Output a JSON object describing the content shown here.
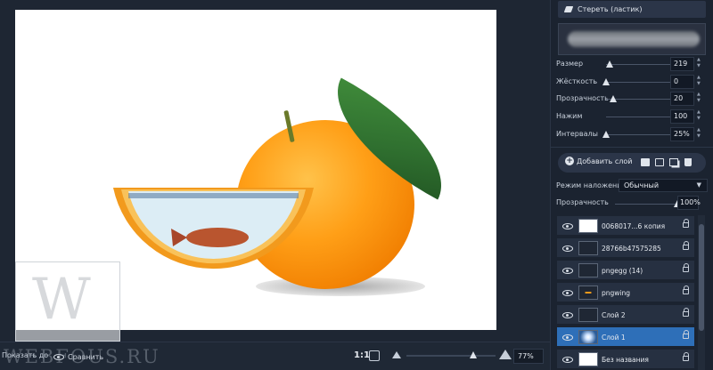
{
  "bottom_bar": {
    "label_left": "Показать до",
    "compare_label": "Сравнить",
    "ratio_label": "1:1",
    "zoom_value": "77%",
    "zoom_level": 0.75
  },
  "watermark": {
    "letter": "W",
    "text": "WEBFOUS.RU"
  },
  "tool": {
    "eraser_label": "Стереть (ластик)"
  },
  "params": [
    {
      "label": "Размер",
      "value": "219",
      "level": 0.05
    },
    {
      "label": "Жёсткость",
      "value": "0",
      "level": 0.0
    },
    {
      "label": "Прозрачность",
      "value": "20",
      "level": 0.1
    },
    {
      "label": "Нажим",
      "value": "100",
      "level": 1.0
    },
    {
      "label": "Интервалы",
      "value": "25%",
      "level": 0.0
    }
  ],
  "layers_panel": {
    "add_layer_label": "Добавить слой",
    "blend_label": "Режим наложения:",
    "blend_value": "Обычный",
    "opacity_label": "Прозрачность",
    "opacity_value": "100%",
    "opacity_level": 1.0
  },
  "layers": [
    {
      "name": "0068017...6 копия",
      "selected": false,
      "thumb": "white"
    },
    {
      "name": "28766b47575285",
      "selected": false,
      "thumb": "dark"
    },
    {
      "name": "pngegg (14)",
      "selected": false,
      "thumb": "dark"
    },
    {
      "name": "pngwing",
      "selected": false,
      "thumb": "orange"
    },
    {
      "name": "Слой 2",
      "selected": false,
      "thumb": "dark"
    },
    {
      "name": "Слой 1",
      "selected": true,
      "thumb": "glow"
    },
    {
      "name": "Без названия",
      "selected": false,
      "thumb": "white"
    }
  ]
}
